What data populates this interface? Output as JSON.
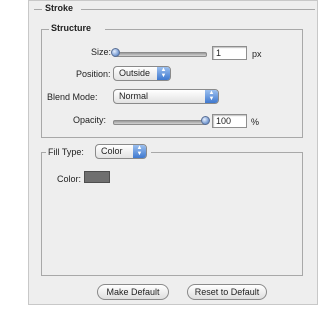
{
  "stroke": {
    "title": "Stroke",
    "structure": {
      "title": "Structure",
      "size": {
        "label": "Size:",
        "value": "1",
        "unit": "px"
      },
      "position": {
        "label": "Position:",
        "selected": "Outside"
      },
      "blend_mode": {
        "label": "Blend Mode:",
        "selected": "Normal"
      },
      "opacity": {
        "label": "Opacity:",
        "value": "100",
        "unit": "%",
        "level": 1.0
      }
    },
    "fill": {
      "label": "Fill Type:",
      "selected": "Color",
      "color_label": "Color:",
      "color_hex": "#6f6f6f"
    },
    "buttons": {
      "make_default": "Make Default",
      "reset_default": "Reset to Default"
    }
  }
}
